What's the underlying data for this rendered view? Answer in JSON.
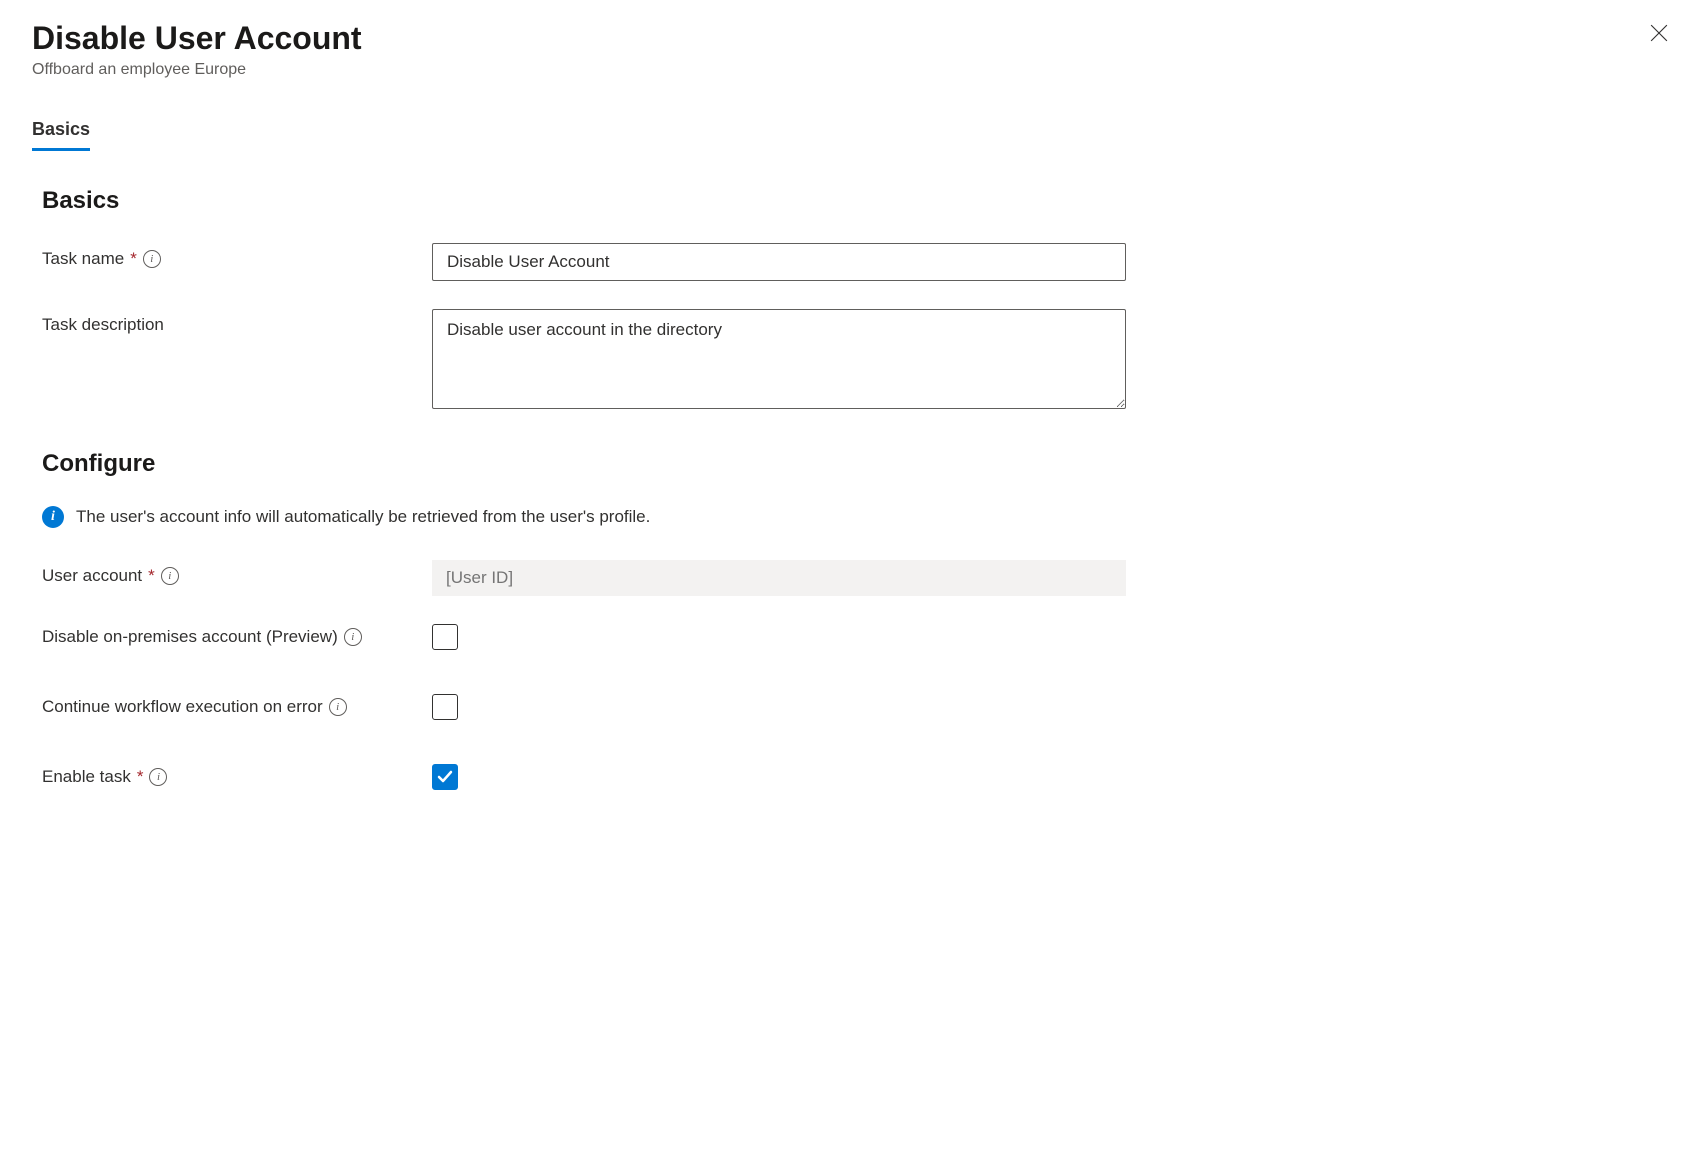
{
  "header": {
    "title": "Disable User Account",
    "subtitle": "Offboard an employee Europe"
  },
  "tabs": {
    "basics": "Basics"
  },
  "sections": {
    "basics_title": "Basics",
    "configure_title": "Configure"
  },
  "form": {
    "task_name_label": "Task name",
    "task_name_value": "Disable User Account",
    "task_description_label": "Task description",
    "task_description_value": "Disable user account in the directory",
    "user_account_label": "User account",
    "user_account_placeholder": "[User ID]",
    "disable_onprem_label": "Disable on-premises account (Preview)",
    "continue_on_error_label": "Continue workflow execution on error",
    "enable_task_label": "Enable task"
  },
  "info_banner": {
    "text": "The user's account info will automatically be retrieved from the user's profile."
  },
  "checkboxes": {
    "disable_onprem": false,
    "continue_on_error": false,
    "enable_task": true
  }
}
